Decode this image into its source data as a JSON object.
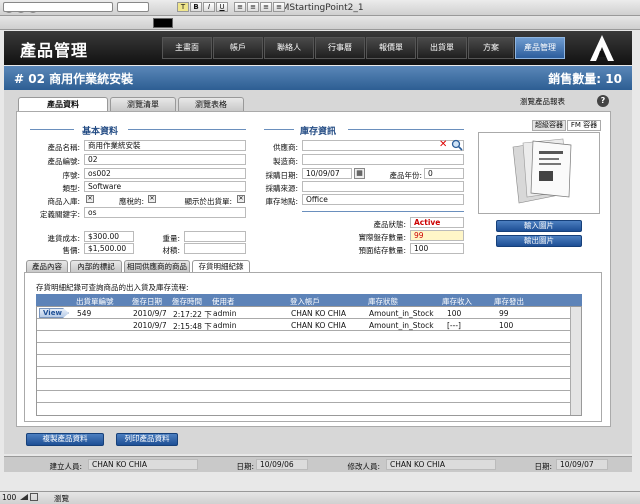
{
  "window": {
    "title": "FMStartingPoint2_1"
  },
  "app": {
    "title": "產品管理"
  },
  "nav": [
    "主畫面",
    "帳戶",
    "聯絡人",
    "行事曆",
    "報價單",
    "出貨單",
    "方案",
    "產品管理"
  ],
  "record": {
    "title": "# 02 商用作業統安裝",
    "sales_label": "銷售數量:",
    "sales_value": "10"
  },
  "tabs": [
    "產品資料",
    "瀏覽清單",
    "瀏覽表格"
  ],
  "browse_report": "瀏覽產品報表",
  "basic": {
    "title": "基本資料",
    "name_label": "產品名稱:",
    "name": "商用作業統安裝",
    "code_label": "產品編號:",
    "code": "02",
    "serial_label": "序號:",
    "serial": "os002",
    "category_label": "類型:",
    "category": "Software",
    "instock_label": "商品入庫:",
    "taxable_label": "應稅的:",
    "show_label": "顯示於出貨單:",
    "keyword_label": "定義關鍵字:",
    "keyword": "os",
    "cost_label": "進貨成本:",
    "cost": "$300.00",
    "price_label": "售價:",
    "price": "$1,500.00",
    "weight_label": "重量:",
    "material_label": "材積:"
  },
  "inventory": {
    "title": "庫存資訊",
    "supplier_label": "供應商:",
    "maker_label": "製造商:",
    "date_label": "採購日期:",
    "date": "10/09/07",
    "year_label": "產品年份:",
    "year": "0",
    "source_label": "採購來源:",
    "location_label": "庫存地點:",
    "location": "Office",
    "status_label": "產品狀態:",
    "status": "Active",
    "actual_label": "實際盤存數量:",
    "actual": "99",
    "reserved_label": "預面結存數量:",
    "reserved": "100"
  },
  "image_tabs": [
    "超級容器",
    "FM 容器"
  ],
  "image_buttons": [
    "輸入圖片",
    "輸出圖片"
  ],
  "subtabs": [
    "產品內容",
    "內部的標記",
    "相同供應商的商品",
    "存貨明細紀錄"
  ],
  "ledger": {
    "caption": "存貨明細紀錄可查詢商品的出入貨及庫存流程:",
    "headers": [
      "出貨單編號",
      "盤存日期",
      "盤存時間",
      "使用者",
      "登入帳戶",
      "庫存狀態",
      "庫存收入",
      "庫存發出"
    ],
    "view_label": "View",
    "rows": [
      [
        "549",
        "2010/9/7",
        "2:17:22 下",
        "admin",
        "CHAN KO CHIA",
        "Amount_in_Stock",
        "100",
        "99"
      ],
      [
        "",
        "2010/9/7",
        "2:15:48 下",
        "admin",
        "CHAN KO CHIA",
        "Amount_in_Stock",
        "[---]",
        "100"
      ]
    ]
  },
  "actions": [
    "複製產品資料",
    "列印產品資料"
  ],
  "footer": {
    "creator_label": "建立人員:",
    "creator": "CHAN KO CHIA",
    "created_label": "日期:",
    "created": "10/09/06",
    "modifier_label": "修改人員:",
    "modifier": "CHAN KO CHIA",
    "modified_label": "日期:",
    "modified": "10/09/07"
  },
  "status": {
    "zoom": "100",
    "mode": "瀏覽"
  },
  "colors": {
    "accent": "#2d5e93",
    "active_status": "#cc0000"
  }
}
